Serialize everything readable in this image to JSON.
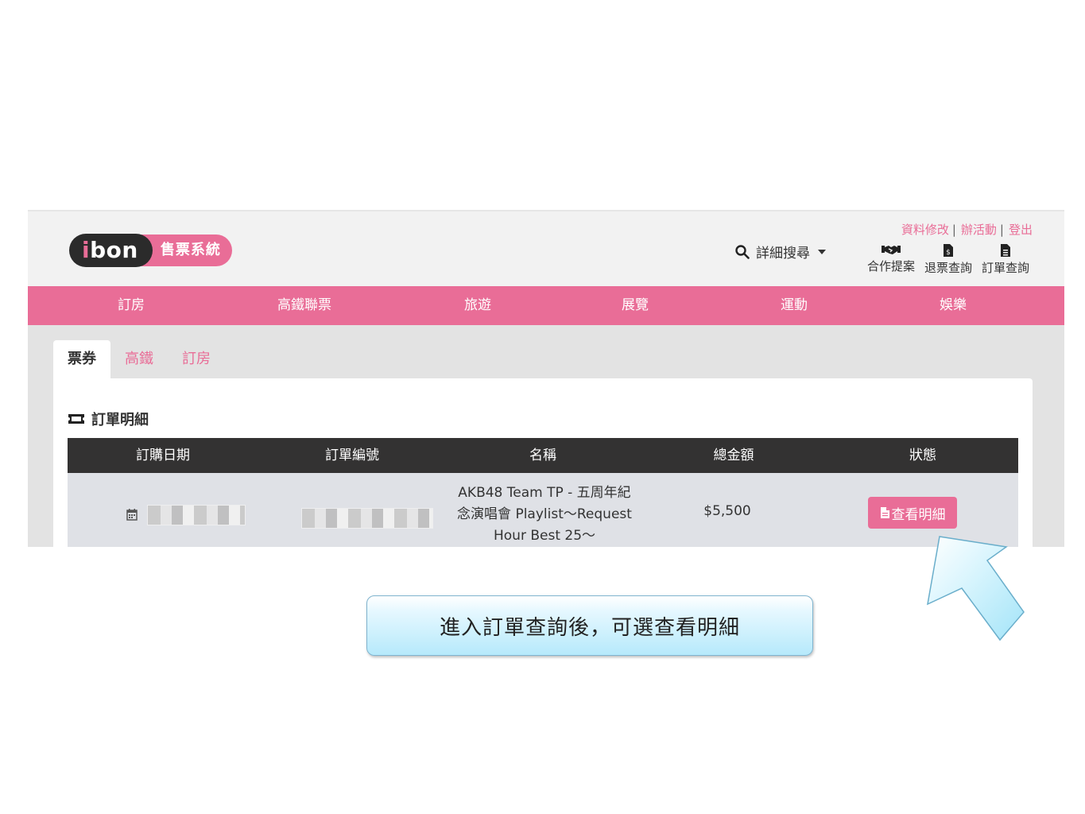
{
  "header": {
    "logo_main": "bon",
    "logo_i": "i",
    "logo_tag": "售票系統",
    "search_label": "詳細搜尋",
    "top_links": [
      "資料修改",
      "辦活動",
      "登出"
    ],
    "quick_links": [
      {
        "label": "合作提案",
        "icon": "handshake-icon"
      },
      {
        "label": "退票查詢",
        "icon": "refund-doc-icon"
      },
      {
        "label": "訂單查詢",
        "icon": "order-doc-icon"
      }
    ]
  },
  "nav": [
    "訂房",
    "高鐵聯票",
    "旅遊",
    "展覽",
    "運動",
    "娛樂"
  ],
  "tabs": [
    "票券",
    "高鐵",
    "訂房"
  ],
  "panel": {
    "title": "訂單明細",
    "columns": [
      "訂購日期",
      "訂單編號",
      "名稱",
      "總金額",
      "狀態"
    ],
    "rows": [
      {
        "name_line1": "AKB48 Team TP - 五周年紀",
        "name_line2": "念演唱會 Playlist～Request",
        "name_line3": "Hour Best 25～",
        "amount": "$5,500",
        "action": "查看明細"
      }
    ]
  },
  "callout": {
    "text": "進入訂單查詢後，可選查看明細"
  },
  "colors": {
    "brand_pink": "#e96d97",
    "dark": "#333232",
    "callout_blue": "#b6e9fb"
  }
}
